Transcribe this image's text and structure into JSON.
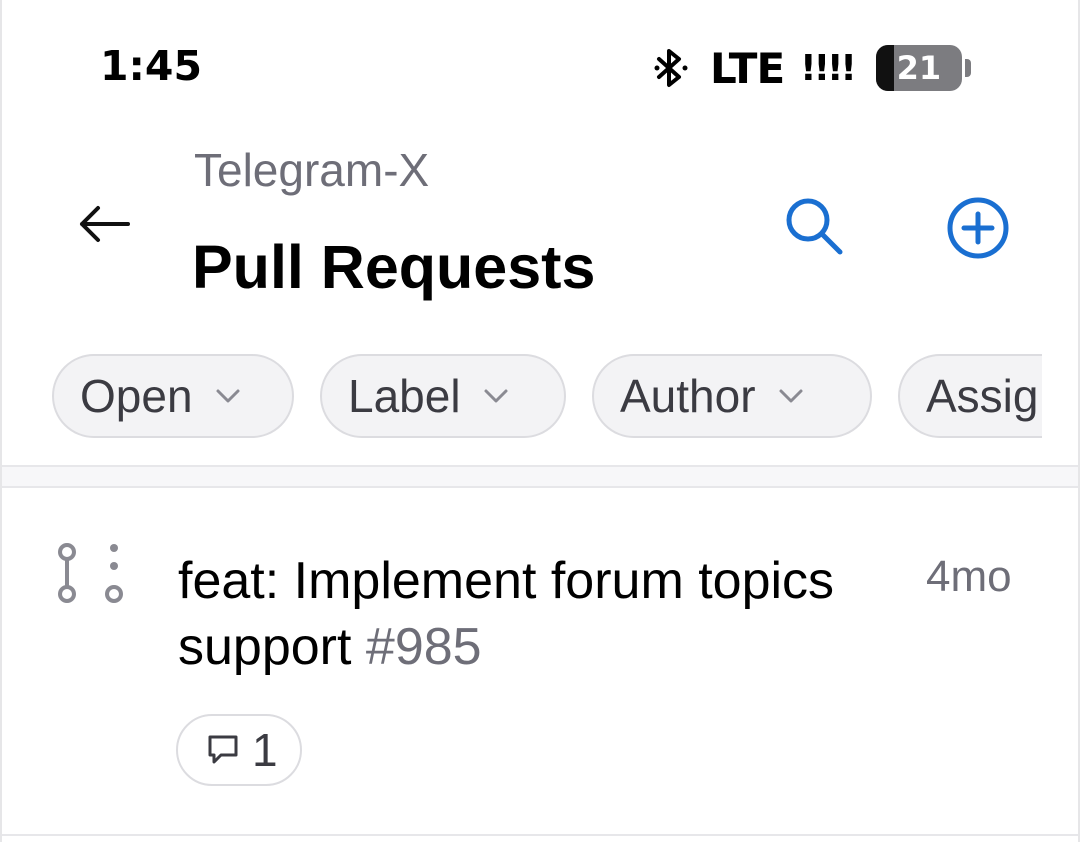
{
  "status_bar": {
    "time": "1:45",
    "network": "LTE",
    "signal": "!!!!",
    "battery_percent": "21",
    "battery_level": 0.21,
    "bluetooth_icon": "bluetooth-icon"
  },
  "header": {
    "back_icon": "arrow-left-icon",
    "repo_name": "Telegram-X",
    "title": "Pull Requests",
    "search_icon": "search-icon",
    "add_icon": "plus-circle-icon"
  },
  "filters": [
    {
      "label": "Open"
    },
    {
      "label": "Label"
    },
    {
      "label": "Author"
    },
    {
      "label": "Assig"
    }
  ],
  "pull_requests": [
    {
      "status_icon": "draft-pull-request-icon",
      "title": "feat: Implement forum topics support",
      "number": "#985",
      "age": "4mo",
      "comment_count": "1"
    }
  ],
  "colors": {
    "accent": "#1a6fd1",
    "text_secondary": "#6e6e78",
    "chip_background": "#f3f3f5"
  }
}
